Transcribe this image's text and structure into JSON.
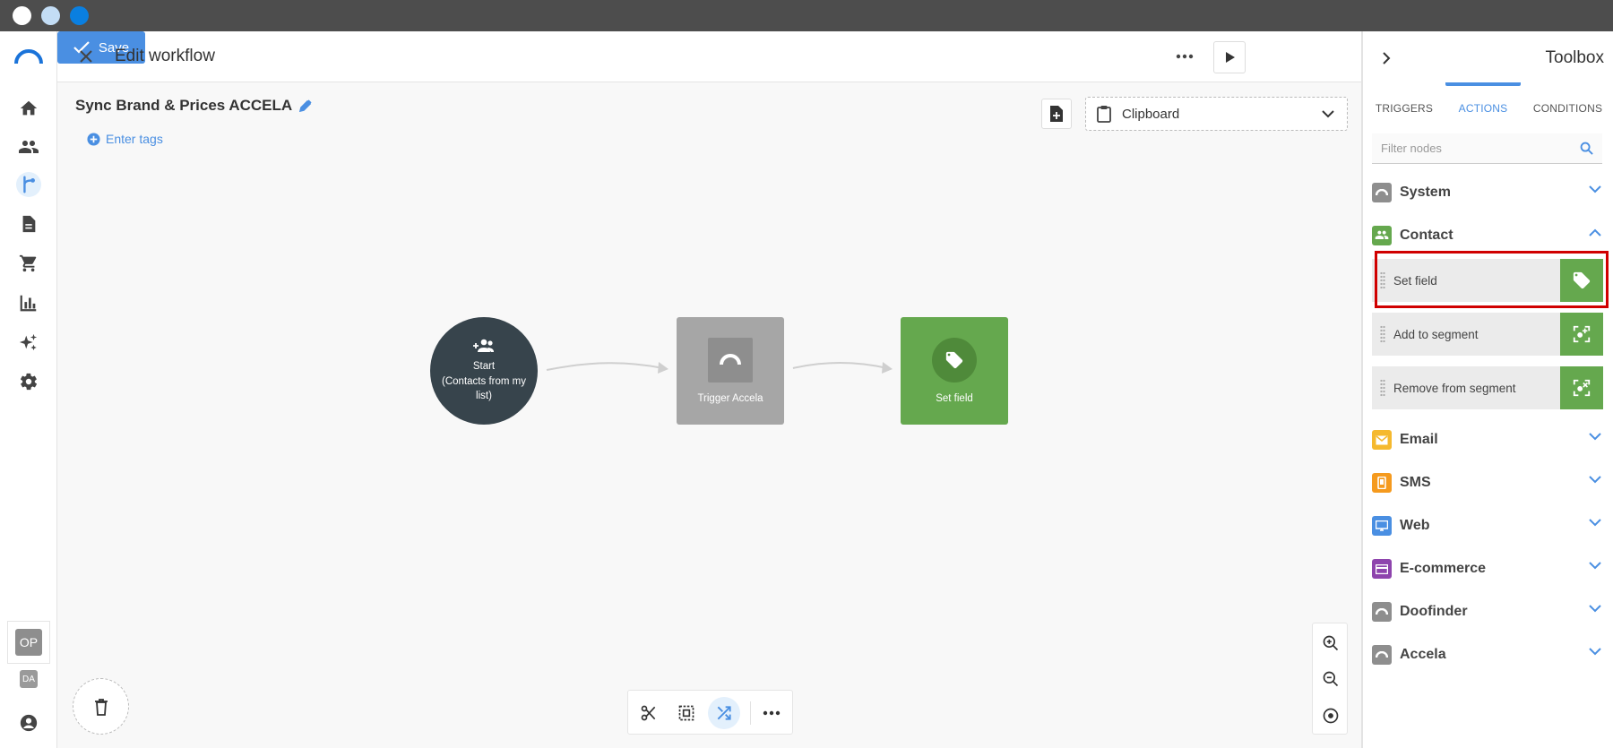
{
  "window": {
    "dots": [
      "#ffffff",
      "#c3ddf5",
      "#0a7fe0"
    ]
  },
  "nav": {
    "items": [
      "home-icon",
      "contacts-icon",
      "workflow-icon",
      "document-icon",
      "cart-icon",
      "chart-icon",
      "sparkle-icon",
      "gear-icon"
    ],
    "active": "workflow-icon",
    "users": [
      "OP",
      "DA"
    ]
  },
  "header": {
    "title": "Edit workflow",
    "save_label": "Save"
  },
  "workflow": {
    "name": "Sync Brand & Prices ACCELA",
    "tags_placeholder": "Enter tags",
    "clipboard_label": "Clipboard"
  },
  "nodes": {
    "start": {
      "label": "Start",
      "sub": "(Contacts from my list)"
    },
    "trigger": {
      "label": "Trigger Accela"
    },
    "setfield": {
      "label": "Set field"
    }
  },
  "toolbox": {
    "title": "Toolbox",
    "tabs": [
      "TRIGGERS",
      "ACTIONS",
      "CONDITIONS"
    ],
    "active_tab": "ACTIONS",
    "filter_placeholder": "Filter nodes",
    "categories": {
      "system": "System",
      "contact": "Contact",
      "email": "Email",
      "sms": "SMS",
      "web": "Web",
      "ecommerce": "E-commerce",
      "doofinder": "Doofinder",
      "accela": "Accela"
    },
    "contact_items": [
      "Set field",
      "Add to segment",
      "Remove from segment"
    ],
    "colors": {
      "green": "#65a84e",
      "blue": "#4a8fe2",
      "highlight": "#d00000"
    }
  }
}
